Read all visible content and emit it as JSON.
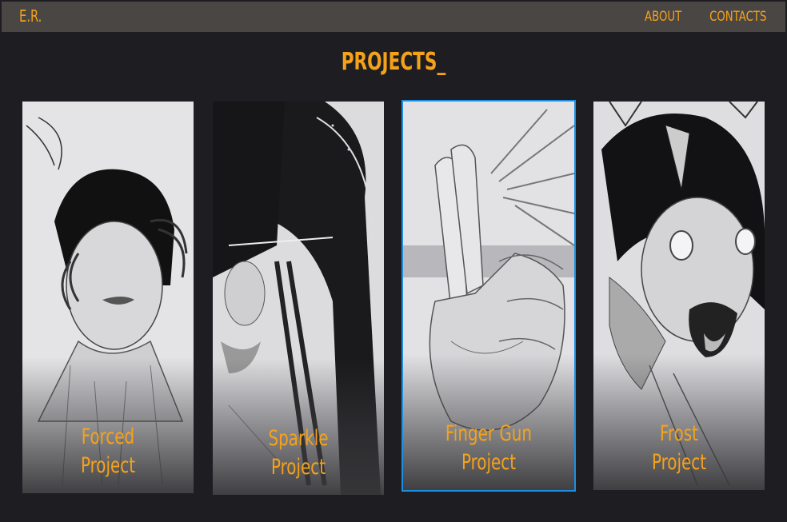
{
  "header": {
    "logo": "E.R.",
    "nav": [
      {
        "label": "ABOUT"
      },
      {
        "label": "CONTACTS"
      }
    ]
  },
  "page": {
    "title": "PROJECTS_"
  },
  "projects": [
    {
      "line1": "Forced",
      "line2": "Project",
      "active": false
    },
    {
      "line1": "Sparkle",
      "line2": "Project",
      "active": false
    },
    {
      "line1": "Finger Gun",
      "line2": "Project",
      "active": true
    },
    {
      "line1": "Frost",
      "line2": "Project",
      "active": false
    }
  ],
  "colors": {
    "background": "#1e1d21",
    "navbar": "#4a4644",
    "accent": "#f5a21b",
    "active_outline": "#1b8fe6"
  }
}
